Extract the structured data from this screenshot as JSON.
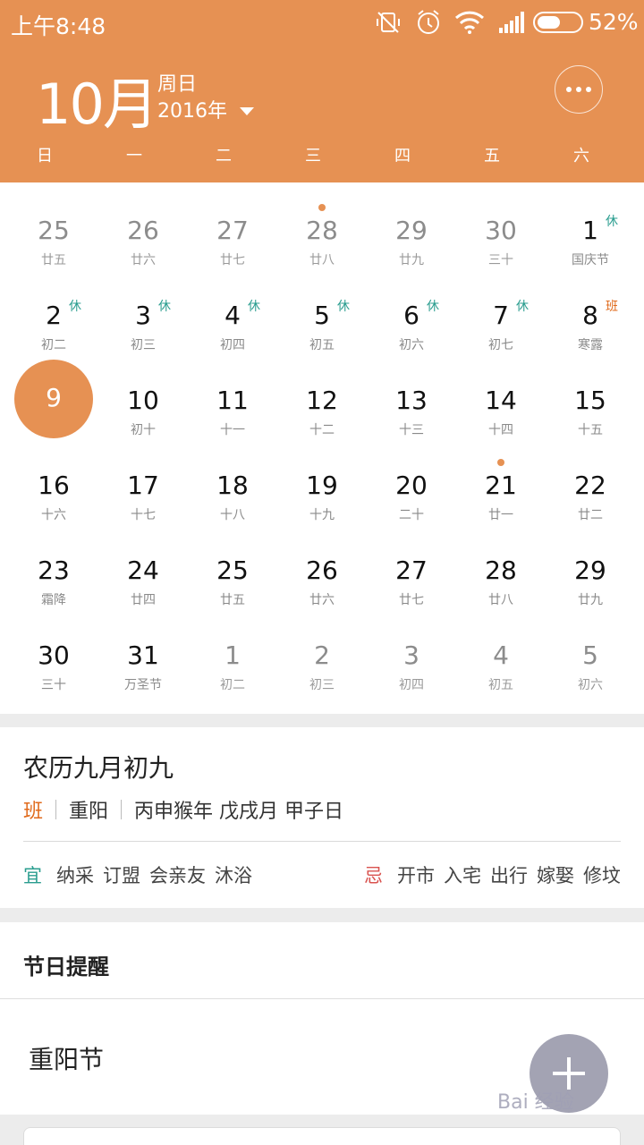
{
  "status": {
    "time": "上午8:48",
    "battery_pct": "52%",
    "battery_level": 0.52
  },
  "header": {
    "month": "10月",
    "weekday": "周日",
    "year": "2016年"
  },
  "week_days": [
    "日",
    "一",
    "二",
    "三",
    "四",
    "五",
    "六"
  ],
  "rows": [
    [
      {
        "d": "25",
        "l": "廿五",
        "other": true
      },
      {
        "d": "26",
        "l": "廿六",
        "other": true
      },
      {
        "d": "27",
        "l": "廿七",
        "other": true
      },
      {
        "d": "28",
        "l": "廿八",
        "other": true,
        "dot": true
      },
      {
        "d": "29",
        "l": "廿九",
        "other": true
      },
      {
        "d": "30",
        "l": "三十",
        "other": true
      },
      {
        "d": "1",
        "l": "国庆节",
        "badge": "休",
        "badge_type": "rest"
      }
    ],
    [
      {
        "d": "2",
        "l": "初二",
        "badge": "休",
        "badge_type": "rest"
      },
      {
        "d": "3",
        "l": "初三",
        "badge": "休",
        "badge_type": "rest"
      },
      {
        "d": "4",
        "l": "初四",
        "badge": "休",
        "badge_type": "rest"
      },
      {
        "d": "5",
        "l": "初五",
        "badge": "休",
        "badge_type": "rest"
      },
      {
        "d": "6",
        "l": "初六",
        "badge": "休",
        "badge_type": "rest"
      },
      {
        "d": "7",
        "l": "初七",
        "badge": "休",
        "badge_type": "rest"
      },
      {
        "d": "8",
        "l": "寒露",
        "badge": "班",
        "badge_type": "work"
      }
    ],
    [
      {
        "d": "9",
        "l": "",
        "selected": true
      },
      {
        "d": "10",
        "l": "初十"
      },
      {
        "d": "11",
        "l": "十一"
      },
      {
        "d": "12",
        "l": "十二"
      },
      {
        "d": "13",
        "l": "十三"
      },
      {
        "d": "14",
        "l": "十四"
      },
      {
        "d": "15",
        "l": "十五"
      }
    ],
    [
      {
        "d": "16",
        "l": "十六"
      },
      {
        "d": "17",
        "l": "十七"
      },
      {
        "d": "18",
        "l": "十八"
      },
      {
        "d": "19",
        "l": "十九"
      },
      {
        "d": "20",
        "l": "二十"
      },
      {
        "d": "21",
        "l": "廿一",
        "dot": true
      },
      {
        "d": "22",
        "l": "廿二"
      }
    ],
    [
      {
        "d": "23",
        "l": "霜降"
      },
      {
        "d": "24",
        "l": "廿四"
      },
      {
        "d": "25",
        "l": "廿五"
      },
      {
        "d": "26",
        "l": "廿六"
      },
      {
        "d": "27",
        "l": "廿七"
      },
      {
        "d": "28",
        "l": "廿八"
      },
      {
        "d": "29",
        "l": "廿九"
      }
    ],
    [
      {
        "d": "30",
        "l": "三十"
      },
      {
        "d": "31",
        "l": "万圣节"
      },
      {
        "d": "1",
        "l": "初二",
        "other": true
      },
      {
        "d": "2",
        "l": "初三",
        "other": true
      },
      {
        "d": "3",
        "l": "初四",
        "other": true
      },
      {
        "d": "4",
        "l": "初五",
        "other": true
      },
      {
        "d": "5",
        "l": "初六",
        "other": true
      }
    ]
  ],
  "detail": {
    "lunar_date": "农历九月初九",
    "tag_work": "班",
    "festival": "重阳",
    "ganzhi": "丙申猴年 戊戌月 甲子日",
    "yi_label": "宜",
    "yi_items": [
      "纳采",
      "订盟",
      "会亲友",
      "沐浴"
    ],
    "ji_label": "忌",
    "ji_items": [
      "开市",
      "入宅",
      "出行",
      "嫁娶",
      "修坟"
    ]
  },
  "festival_card": {
    "title": "节日提醒",
    "item": "重阳节"
  },
  "watermark": "Bai 经验",
  "colors": {
    "accent": "#e69153",
    "rest": "#2a9d8f",
    "work": "#e06a1b"
  }
}
